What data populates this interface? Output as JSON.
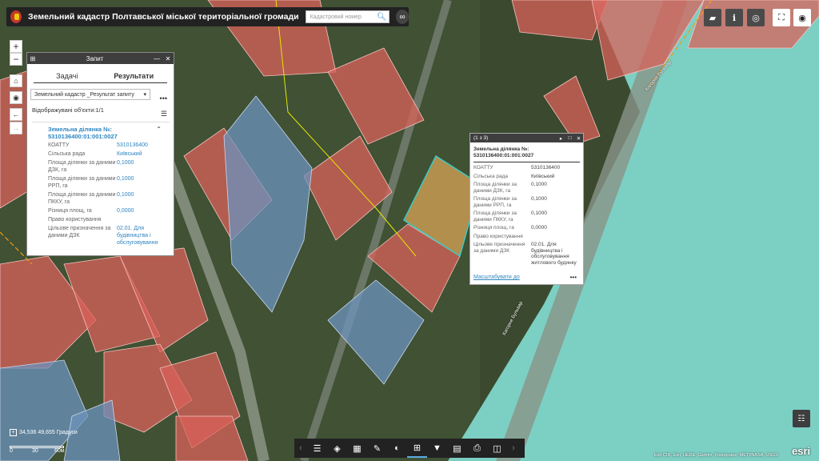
{
  "app": {
    "title": "Земельний кадастр Полтавської міської територіальної громади"
  },
  "search": {
    "placeholder": "Кадастровий номер"
  },
  "header_icons": [
    "search-icon",
    "link-icon"
  ],
  "top_right_icons": [
    "basemap-icon",
    "info-icon",
    "layers-icon",
    "fullscreen-icon",
    "visibility-icon"
  ],
  "zoom": {
    "in": "+",
    "out": "−"
  },
  "query_panel": {
    "title": "Запит",
    "tabs": [
      {
        "label": "Задачі"
      },
      {
        "label": "Результати"
      }
    ],
    "select_value": "Земельний кадастр _Результат запиту",
    "count_text": "Відображувані об'єкти:1/1",
    "item": {
      "title": "Земельна ділянка №: 5310136400:01:001:0027",
      "rows": [
        {
          "k": "КОАТТУ",
          "v": "5310136400"
        },
        {
          "k": "Сільська рада",
          "v": "Київський"
        },
        {
          "k": "Площа ділянки за даними ДЗК, га",
          "v": "0,1000"
        },
        {
          "k": "Площа ділянки за даними РРП, га",
          "v": "0,1000"
        },
        {
          "k": "Площа ділянки за даними ПККУ, га",
          "v": "0,1000"
        },
        {
          "k": "Різниця площ, га",
          "v": "0,0000"
        },
        {
          "k": "Право користування",
          "v": ""
        },
        {
          "k": "Цільове призначення за даними ДЗК",
          "v": "02.01. Для будівництва і обслуговування"
        }
      ]
    }
  },
  "popup": {
    "header": "(1 з 3)",
    "title": "Земельна ділянка №: 5310136400:01:001:0027",
    "rows": [
      {
        "k": "КОАТТУ",
        "v": "5310136400"
      },
      {
        "k": "Сільська рада",
        "v": "Київський"
      },
      {
        "k": "Площа ділянки за даними ДЗК, га",
        "v": "0,1000"
      },
      {
        "k": "Площа ділянки за даними РРП, га",
        "v": "0,1000"
      },
      {
        "k": "Площа ділянки за даними ПККУ, га",
        "v": "0,1000"
      },
      {
        "k": "Різниця площ, га",
        "v": "0,0000"
      },
      {
        "k": "Право користування",
        "v": ""
      },
      {
        "k": "Цільове призначення за даними ДЗК",
        "v": "02.01. Для будівництва і обслуговування житлового будинку"
      }
    ],
    "zoom_link": "Масштабувати до"
  },
  "coords": {
    "text": "34,536 49,655 Градуси"
  },
  "scale": {
    "labels": [
      "0",
      "30",
      "60м"
    ]
  },
  "toolbar_icons": [
    "list-icon",
    "layers-icon",
    "grid-icon",
    "draw-icon",
    "palette-icon",
    "query-icon",
    "filter-icon",
    "edit-icon",
    "print-icon",
    "swipe-icon"
  ],
  "street": {
    "label": "Кагорне Бульвар"
  },
  "attribution": {
    "text": "Esri CIR, Esri, HERE, Garmin, Foursquare, METI/NASA, USGS",
    "powered": "esri"
  },
  "colors": {
    "parcel_red": "#d9625a",
    "parcel_blue": "#6c93bd",
    "parcel_selected": "#c89a54",
    "selected_outline": "#3ec8c0",
    "water": "#7ccfc3"
  }
}
